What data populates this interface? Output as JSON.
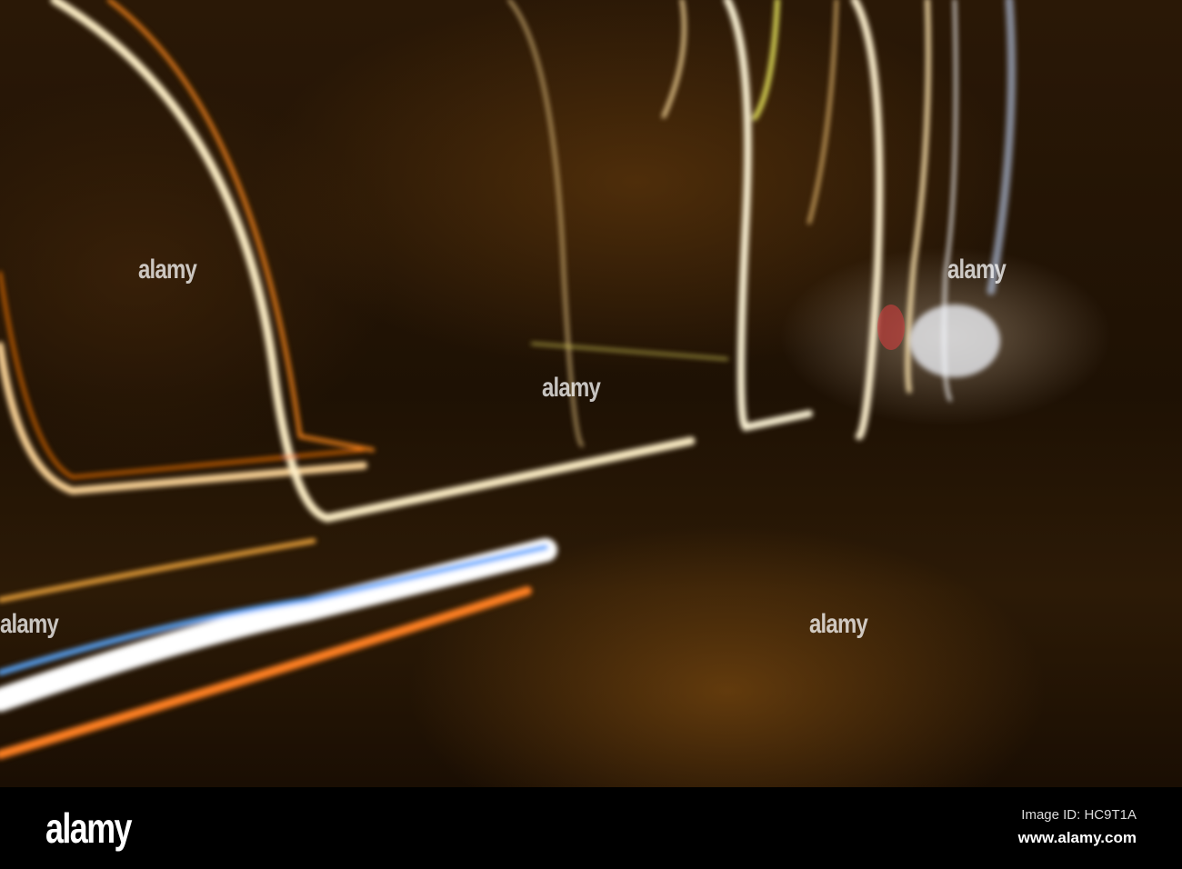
{
  "watermark": "alamy",
  "footer": {
    "logo": "alamy",
    "image_id": "Image ID: HC9T1A",
    "url": "www.alamy.com"
  }
}
